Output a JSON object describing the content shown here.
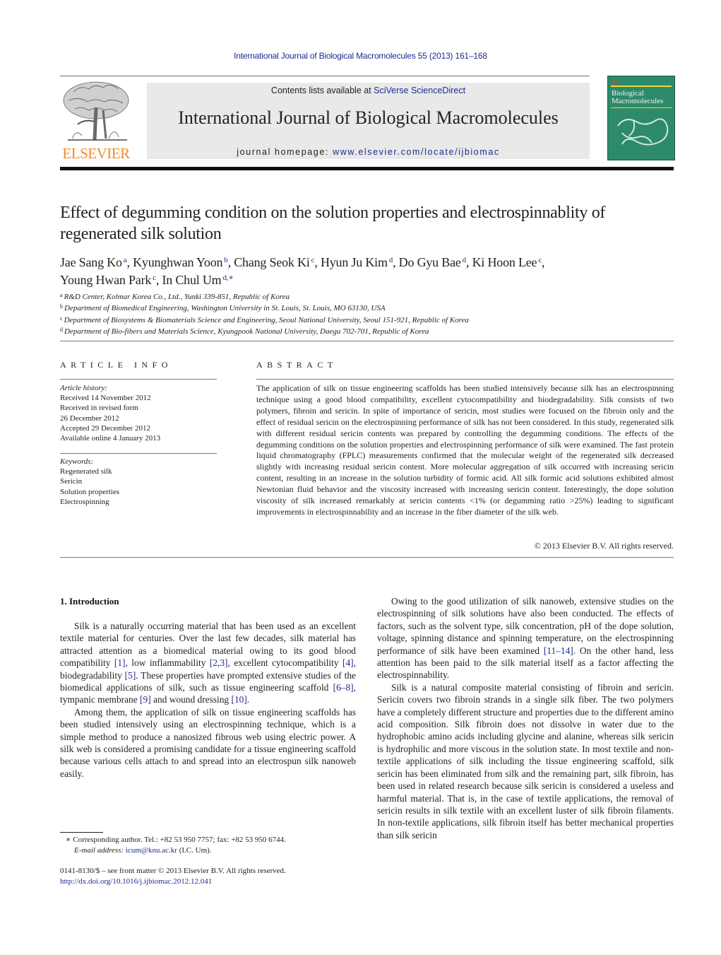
{
  "running_head": "International Journal of Biological Macromolecules 55 (2013) 161–168",
  "masthead": {
    "publisher_logo_text": "ELSEVIER",
    "contents_prefix": "Contents lists available at ",
    "contents_link": "SciVerse ScienceDirect",
    "journal_name": "International Journal of Biological Macromolecules",
    "homepage_prefix": "journal homepage: ",
    "homepage_link": "www.elsevier.com/locate/ijbiomac",
    "cover_title_line1": "Biological",
    "cover_title_line2": "Macromolecules",
    "colors": {
      "elsevier_orange": "#f28c28",
      "link_blue": "#1f2b8f",
      "masthead_gray": "#e9e9e9",
      "cover_green": "#2d8a6a"
    }
  },
  "article": {
    "title": "Effect of degumming condition on the solution properties and electrospinnablity of regenerated silk solution",
    "authors": [
      {
        "name": "Jae Sang Ko",
        "aff": "a",
        "sep": ", "
      },
      {
        "name": "Kyunghwan Yoon",
        "aff": "b",
        "sep": ", "
      },
      {
        "name": "Chang Seok Ki",
        "aff": "c",
        "sep": ", "
      },
      {
        "name": "Hyun Ju Kim",
        "aff": "d",
        "sep": ", "
      },
      {
        "name": "Do Gyu Bae",
        "aff": "d",
        "sep": ", "
      },
      {
        "name": "Ki Hoon Lee",
        "aff": "c",
        "sep": ","
      },
      {
        "name": "Young Hwan Park",
        "aff": "c",
        "sep": ", "
      },
      {
        "name": "In Chul Um",
        "aff": "d,∗",
        "sep": ""
      }
    ],
    "affiliations": [
      {
        "key": "a",
        "text": "R&D Center, Kolmar Korea Co., Ltd., Yunki 339-851, Republic of Korea"
      },
      {
        "key": "b",
        "text": "Department of Biomedical Engineering, Washington University in St. Louis, St. Louis, MO 63130, USA"
      },
      {
        "key": "c",
        "text": "Department of Biosystems & Biomaterials Science and Engineering, Seoul National University, Seoul 151-921, Republic of Korea"
      },
      {
        "key": "d",
        "text": "Department of Bio-fibers and Materials Science, Kyungpook National University, Daegu 702-701, Republic of Korea"
      }
    ]
  },
  "article_info": {
    "heading": "ARTICLE INFO",
    "history_label": "Article history:",
    "history": [
      "Received 14 November 2012",
      "Received in revised form",
      "26 December 2012",
      "Accepted 29 December 2012",
      "Available online 4 January 2013"
    ],
    "keywords_label": "Keywords:",
    "keywords": [
      "Regenerated silk",
      "Sericin",
      "Solution properties",
      "Electrospinning"
    ]
  },
  "abstract": {
    "heading": "ABSTRACT",
    "text": "The application of silk on tissue engineering scaffolds has been studied intensively because silk has an electrospinning technique using a good blood compatibility, excellent cytocompatibility and biodegradability. Silk consists of two polymers, fibroin and sericin. In spite of importance of sericin, most studies were focused on the fibroin only and the effect of residual sericin on the electrospinning performance of silk has not been considered. In this study, regenerated silk with different residual sericin contents was prepared by controlling the degumming conditions. The effects of the degumming conditions on the solution properties and electrospinning performance of silk were examined. The fast protein liquid chromatography (FPLC) measurements confirmed that the molecular weight of the regenerated silk decreased slightly with increasing residual sericin content. More molecular aggregation of silk occurred with increasing sericin content, resulting in an increase in the solution turbidity of formic acid. All silk formic acid solutions exhibited almost Newtonian fluid behavior and the viscosity increased with increasing sericin content. Interestingly, the dope solution viscosity of silk increased remarkably at sericin contents <1% (or degumming ratio >25%) leading to significant improvements in electrospinnability and an increase in the fiber diameter of the silk web.",
    "copyright": "© 2013 Elsevier B.V. All rights reserved."
  },
  "introduction": {
    "heading": "1.  Introduction",
    "left_paragraphs": [
      [
        {
          "t": "Silk is a naturally occurring material that has been used as an excellent textile material for centuries. Over the last few decades, silk material has attracted attention as a biomedical material owing to its good blood compatibility "
        },
        {
          "c": "[1]"
        },
        {
          "t": ", low inflammability "
        },
        {
          "c": "[2,3]"
        },
        {
          "t": ", excellent cytocompatibility "
        },
        {
          "c": "[4]"
        },
        {
          "t": ", biodegradability "
        },
        {
          "c": "[5]"
        },
        {
          "t": ". These properties have prompted extensive studies of the biomedical applications of silk, such as tissue engineering scaffold "
        },
        {
          "c": "[6–8]"
        },
        {
          "t": ", tympanic membrane "
        },
        {
          "c": "[9]"
        },
        {
          "t": " and wound dressing "
        },
        {
          "c": "[10]"
        },
        {
          "t": "."
        }
      ],
      [
        {
          "t": "Among them, the application of silk on tissue engineering scaffolds has been studied intensively using an electrospinning technique, which is a simple method to produce a nanosized fibrous web using electric power. A silk web is considered a promising candidate for a tissue engineering scaffold because various cells attach to and spread into an electrospun silk nanoweb easily."
        }
      ]
    ],
    "right_paragraphs": [
      [
        {
          "t": "Owing to the good utilization of silk nanoweb, extensive studies on the electrospinning of silk solutions have also been conducted. The effects of factors, such as the solvent type, silk concentration, pH of the dope solution, voltage, spinning distance and spinning temperature, on the electrospinning performance of silk have been examined "
        },
        {
          "c": "[11–14]"
        },
        {
          "t": ". On the other hand, less attention has been paid to the silk material itself as a factor affecting the electrospinnability."
        }
      ],
      [
        {
          "t": "Silk is a natural composite material consisting of fibroin and sericin. Sericin covers two fibroin strands in a single silk fiber. The two polymers have a completely different structure and properties due to the different amino acid composition. Silk fibroin does not dissolve in water due to the hydrophobic amino acids including glycine and alanine, whereas silk sericin is hydrophilic and more viscous in the solution state. In most textile and non-textile applications of silk including the tissue engineering scaffold, silk sericin has been eliminated from silk and the remaining part, silk fibroin, has been used in related research because silk sericin is considered a useless and harmful material. That is, in the case of textile applications, the removal of sericin results in silk textile with an excellent luster of silk fibroin filaments. In non-textile applications, silk fibroin itself has better mechanical properties than silk sericin"
        }
      ]
    ]
  },
  "footnotes": {
    "corresponding": "∗  Corresponding author. Tel.: +82 53 950 7757; fax: +82 53 950 6744.",
    "email_label": "E-mail address: ",
    "email": "icum@knu.ac.kr",
    "email_suffix": " (I.C. Um).",
    "issn": "0141-8130/$ – see front matter © 2013 Elsevier B.V. All rights reserved.",
    "doi": "http://dx.doi.org/10.1016/j.ijbiomac.2012.12.041"
  }
}
